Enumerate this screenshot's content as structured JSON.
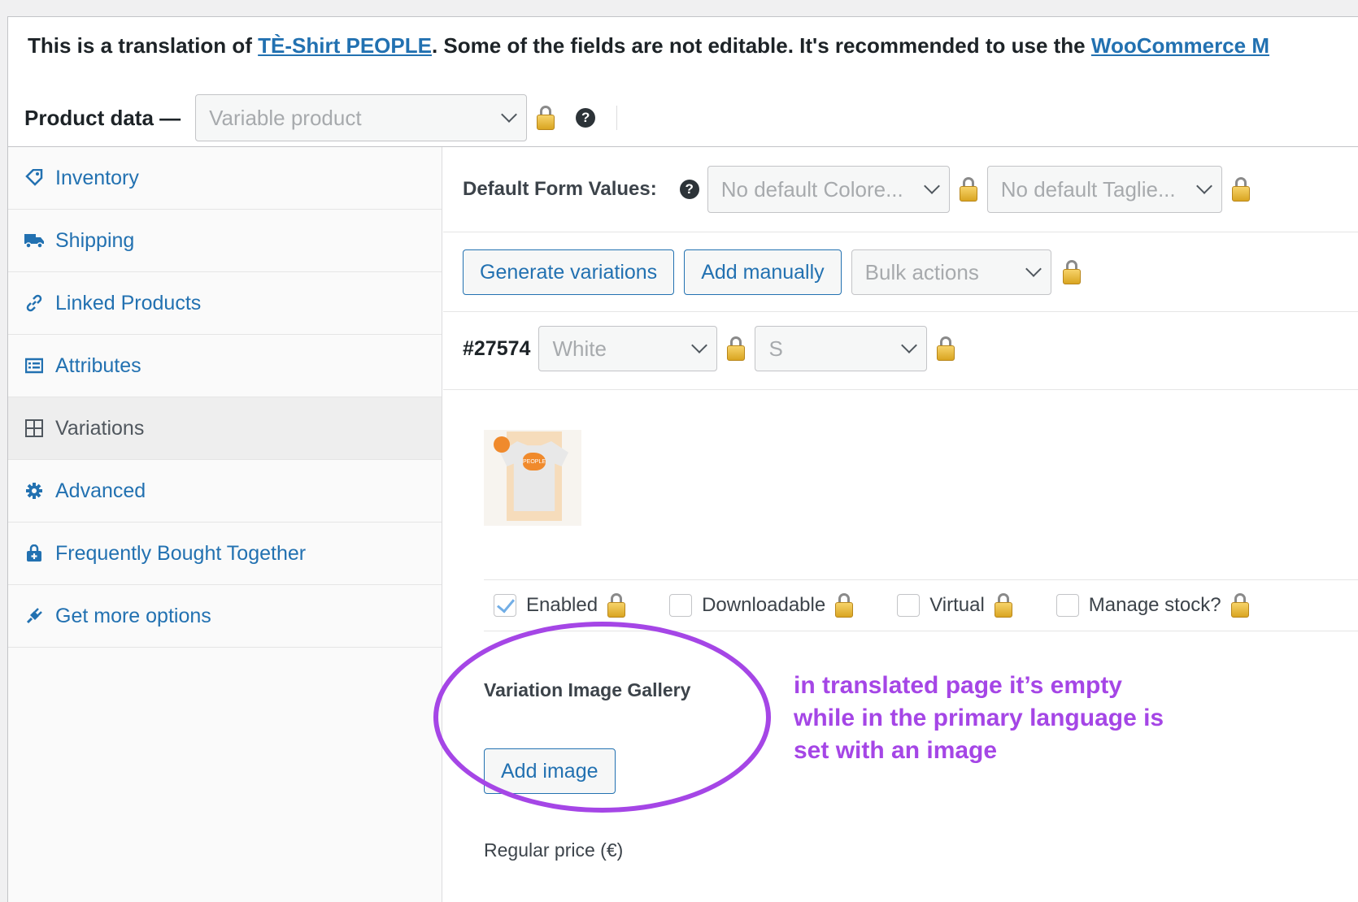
{
  "notice": {
    "prefix": "This is a translation of ",
    "link_text": "TÈ-Shirt PEOPLE",
    "middle": ". Some of the fields are not editable. It's recommended to use the ",
    "link2_text": "WooCommerce M"
  },
  "product_data": {
    "label": "Product data —",
    "type_value": "Variable product",
    "help": "?"
  },
  "tabs": [
    {
      "label": "Inventory",
      "icon": "tag-icon"
    },
    {
      "label": "Shipping",
      "icon": "truck-icon"
    },
    {
      "label": "Linked Products",
      "icon": "link-icon"
    },
    {
      "label": "Attributes",
      "icon": "list-icon"
    },
    {
      "label": "Variations",
      "icon": "grid-icon",
      "active": true
    },
    {
      "label": "Advanced",
      "icon": "gear-icon"
    },
    {
      "label": "Frequently Bought Together",
      "icon": "bag-icon"
    },
    {
      "label": "Get more options",
      "icon": "plugin-icon"
    }
  ],
  "variations": {
    "default_form_label": "Default Form Values:",
    "help": "?",
    "default_color": "No default Colore...",
    "default_size": "No default Taglie...",
    "generate_button": "Generate variations",
    "add_manually_button": "Add manually",
    "bulk_actions": "Bulk actions",
    "variation_id": "#27574",
    "variation_color": "White",
    "variation_size": "S",
    "thumb_text": "PEOPLE",
    "checkboxes": [
      {
        "label": "Enabled",
        "checked": true
      },
      {
        "label": "Downloadable",
        "checked": false
      },
      {
        "label": "Virtual",
        "checked": false
      },
      {
        "label": "Manage stock?",
        "checked": false
      }
    ],
    "gallery_title": "Variation Image Gallery",
    "add_image_button": "Add image",
    "regular_price_label": "Regular price (€)"
  },
  "annotation": {
    "text_line1": "in translated page it’s empty",
    "text_line2": "while in the primary language is",
    "text_line3": "set with an image",
    "color": "#a546e6"
  },
  "colors": {
    "link": "#2271b1",
    "lock": "#e0b030"
  }
}
